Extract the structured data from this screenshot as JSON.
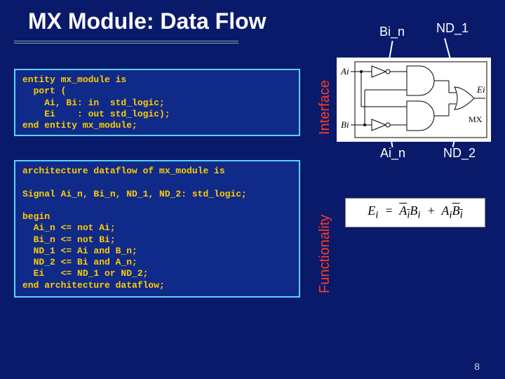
{
  "title": "MX Module: Data Flow",
  "page_number": "8",
  "labels": {
    "interface": "Interface",
    "functionality": "Functionality",
    "bi_n": "Bi_n",
    "nd_1": "ND_1",
    "ai_n": "Ai_n",
    "nd_2": "ND_2"
  },
  "code": {
    "entity": "entity mx_module is\n  port (\n    Ai, Bi: in  std_logic;\n    Ei    : out std_logic);\nend entity mx_module;",
    "architecture": "architecture dataflow of mx_module is\n\nSignal Ai_n, Bi_n, ND_1, ND_2: std_logic;\n\nbegin\n  Ai_n <= not Ai;\n  Bi_n <= not Bi;\n  ND_1 <= Ai and B_n;\n  ND_2 <= Bi and A_n;\n  Ei   <= ND_1 or ND_2;\nend architecture dataflow;"
  },
  "equation": {
    "lhs": "E",
    "lhs_sub": "i",
    "t1a": "A",
    "t1a_sub": "i",
    "t1b": "B",
    "t1b_sub": "i",
    "t2a": "A",
    "t2a_sub": "i",
    "t2b": "B",
    "t2b_sub": "i"
  },
  "circuit_labels": {
    "Ai": "Ai",
    "Bi": "Bi",
    "Ei": "Ei",
    "MX": "MX"
  }
}
